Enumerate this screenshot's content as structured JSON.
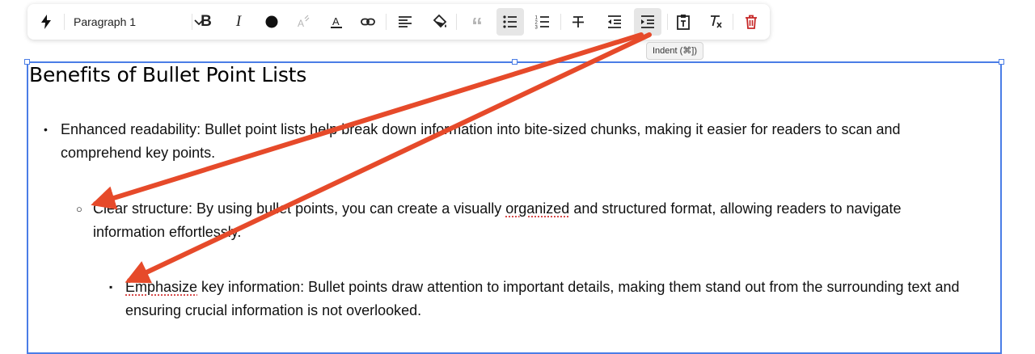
{
  "toolbar": {
    "block_type": "Paragraph 1",
    "icons": [
      "lightning-icon",
      "bold-icon",
      "italic-icon",
      "text-color-icon",
      "highlight-icon",
      "font-style-icon",
      "link-icon",
      "align-left-icon",
      "fill-icon",
      "quote-icon",
      "bulleted-list-icon",
      "numbered-list-icon",
      "strikethrough-icon",
      "outdent-icon",
      "indent-icon",
      "paste-as-text-icon",
      "clear-formatting-icon",
      "delete-icon"
    ],
    "active_buttons": [
      "bulleted-list",
      "indent"
    ],
    "delete_color": "#c62828"
  },
  "tooltip": {
    "text": "Indent (⌘])"
  },
  "document": {
    "title": "Benefits of Bullet Point Lists",
    "items": [
      {
        "level": 1,
        "bullet": "•",
        "text": "Enhanced readability: Bullet point lists help break down information into bite-sized chunks, making it easier for readers to scan and comprehend key points."
      },
      {
        "level": 2,
        "bullet": "○",
        "text_before": "Clear structure: By using bullet points, you can create a visually ",
        "misspelled": "organized",
        "text_after": " and structured format, allowing readers to navigate information effortlessly."
      },
      {
        "level": 3,
        "bullet": "▪",
        "misspelled": "Emphasize",
        "text_after": " key information: Bullet points draw attention to important details, making them stand out from the surrounding text and ensuring crucial information is not overlooked."
      }
    ]
  },
  "colors": {
    "selection_border": "#4a7de6",
    "annotation_arrow": "#e64a2a",
    "active_button_bg": "#e6e6e6"
  }
}
